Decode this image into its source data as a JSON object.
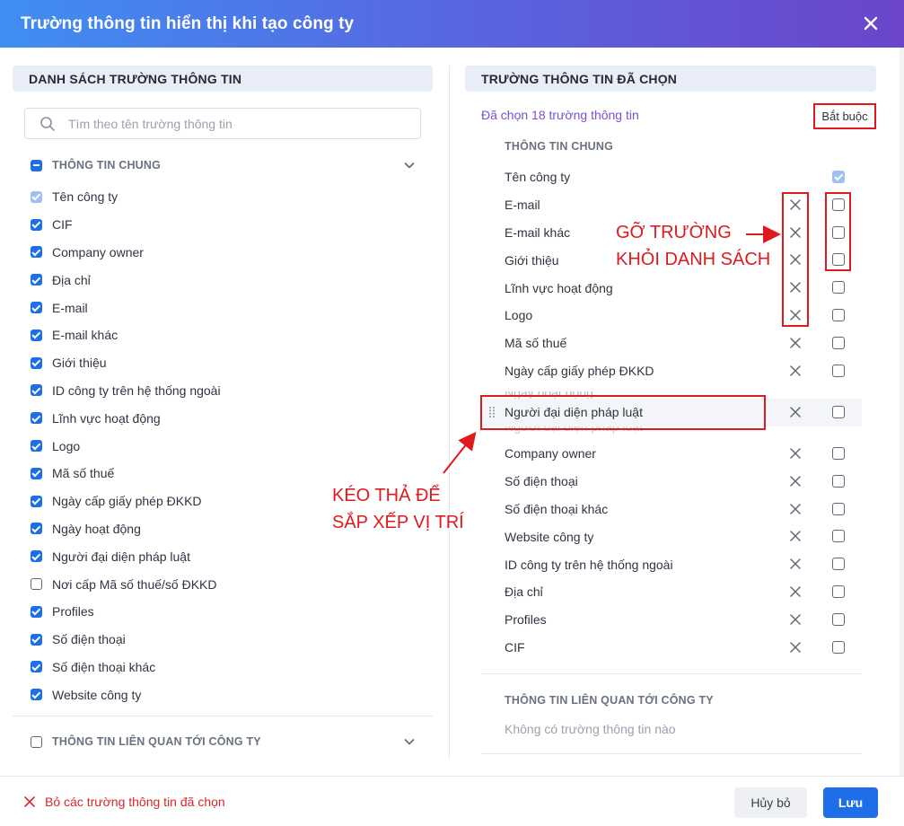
{
  "dialog": {
    "title": "Trường thông tin hiển thị khi tạo công ty"
  },
  "left_panel": {
    "title": "DANH SÁCH TRƯỜNG THÔNG TIN",
    "search_placeholder": "Tìm theo tên trường thông tin",
    "groups": [
      {
        "label": "THÔNG TIN CHUNG",
        "state": "indeterminate",
        "expanded": true,
        "items": [
          {
            "label": "Tên công ty",
            "state": "checked-disabled"
          },
          {
            "label": "CIF",
            "state": "checked"
          },
          {
            "label": "Company owner",
            "state": "checked"
          },
          {
            "label": "Địa chỉ",
            "state": "checked"
          },
          {
            "label": "E-mail",
            "state": "checked"
          },
          {
            "label": "E-mail khác",
            "state": "checked"
          },
          {
            "label": "Giới thiệu",
            "state": "checked"
          },
          {
            "label": "ID công ty trên hệ thống ngoài",
            "state": "checked"
          },
          {
            "label": "Lĩnh vực hoạt động",
            "state": "checked"
          },
          {
            "label": "Logo",
            "state": "checked"
          },
          {
            "label": "Mã số thuế",
            "state": "checked"
          },
          {
            "label": "Ngày cấp giấy phép ĐKKD",
            "state": "checked"
          },
          {
            "label": "Ngày hoạt động",
            "state": "checked"
          },
          {
            "label": "Người đại diện pháp luật",
            "state": "checked"
          },
          {
            "label": "Nơi cấp Mã số thuế/số ĐKKD",
            "state": "unchecked"
          },
          {
            "label": "Profiles",
            "state": "checked"
          },
          {
            "label": "Số điện thoại",
            "state": "checked"
          },
          {
            "label": "Số điện thoại khác",
            "state": "checked"
          },
          {
            "label": "Website công ty",
            "state": "checked"
          }
        ]
      },
      {
        "label": "THÔNG TIN LIÊN QUAN TỚI CÔNG TY",
        "state": "unchecked",
        "expanded": false
      }
    ]
  },
  "right_panel": {
    "title": "TRƯỜNG THÔNG TIN ĐÃ CHỌN",
    "selected_count_text": "Đã chọn 18 trường thông tin",
    "required_header": "Bắt buộc",
    "group1_title": "THÔNG TIN CHUNG",
    "items_top": [
      {
        "label": "Tên công ty",
        "removable": false,
        "required": "checked-disabled"
      },
      {
        "label": "E-mail",
        "removable": true,
        "required": "unchecked"
      },
      {
        "label": "E-mail khác",
        "removable": true,
        "required": "unchecked"
      },
      {
        "label": "Giới thiệu",
        "removable": true,
        "required": "unchecked"
      },
      {
        "label": "Lĩnh vực hoạt động",
        "removable": true,
        "required": "unchecked"
      },
      {
        "label": "Logo",
        "removable": true,
        "required": "unchecked"
      },
      {
        "label": "Mã số thuế",
        "removable": true,
        "required": "unchecked"
      },
      {
        "label": "Ngày cấp giấy phép ĐKKD",
        "removable": true,
        "required": "unchecked"
      }
    ],
    "ghost_label": "Ngày hoạt động",
    "dragging_item": {
      "label": "Người đại diện pháp luật"
    },
    "items_bottom": [
      {
        "label": "Company owner"
      },
      {
        "label": "Số điện thoại"
      },
      {
        "label": "Số điện thoại khác"
      },
      {
        "label": "Website công ty"
      },
      {
        "label": "ID công ty trên hệ thống ngoài"
      },
      {
        "label": "Địa chỉ"
      },
      {
        "label": "Profiles"
      },
      {
        "label": "CIF"
      }
    ],
    "group2_title": "THÔNG TIN LIÊN QUAN TỚI CÔNG TY",
    "group2_empty": "Không có trường thông tin nào"
  },
  "annotations": {
    "remove_line1": "GỠ TRƯỜNG",
    "remove_line2": "KHỎI DANH SÁCH",
    "drag_line1": "KÉO THẢ ĐỂ",
    "drag_line2": "SẮP XẾP VỊ TRÍ",
    "color": "#e0191e"
  },
  "footer": {
    "clear_label": "Bỏ các trường thông tin đã chọn",
    "cancel_label": "Hủy bỏ",
    "save_label": "Lưu"
  },
  "colors": {
    "primary": "#1e6ee8",
    "header_gradient_start": "#3f8ef2",
    "header_gradient_end": "#6b45c9",
    "selected_count": "#7a4fd6",
    "danger": "#d9262b"
  }
}
